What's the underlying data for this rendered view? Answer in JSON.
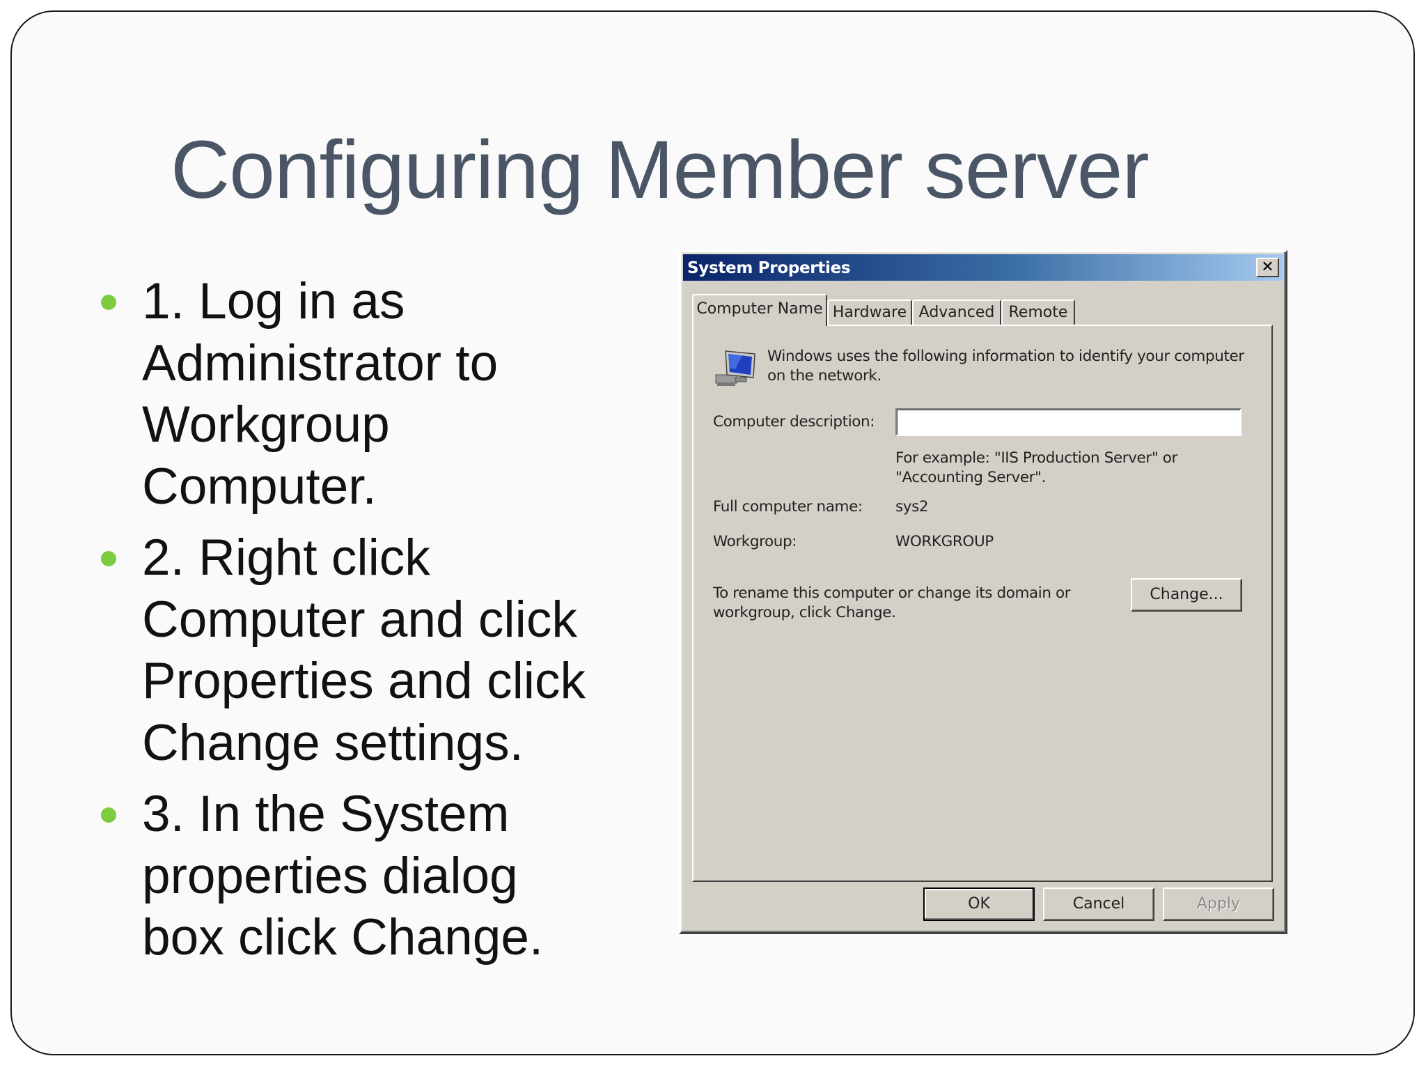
{
  "slide": {
    "title": "Configuring Member server",
    "bullets": [
      [
        "1.  Log in as",
        "Administrator to",
        "Workgroup",
        "Computer."
      ],
      [
        "2.  Right click",
        "Computer and click",
        "Properties and click",
        "Change settings."
      ],
      [
        "3.  In the System",
        "properties dialog",
        "box click Change."
      ]
    ]
  },
  "dialog": {
    "title": "System Properties",
    "close_label": "✕",
    "tabs": [
      "Computer Name",
      "Hardware",
      "Advanced",
      "Remote"
    ],
    "active_tab": "Computer Name",
    "intro_line1": "Windows uses the following information to identify your computer",
    "intro_line2": "on the network.",
    "description_label": "Computer description:",
    "description_value": "",
    "example_line1": "For example: \"IIS Production Server\" or",
    "example_line2": "\"Accounting Server\".",
    "full_name_label": "Full computer name:",
    "full_name_value": "sys2",
    "workgroup_label": "Workgroup:",
    "workgroup_value": "WORKGROUP",
    "rename_line1": "To rename this computer or change its domain or",
    "rename_line2": "workgroup, click Change.",
    "change_button": "Change...",
    "ok_button": "OK",
    "cancel_button": "Cancel",
    "apply_button": "Apply",
    "icon": "computer-monitor-icon"
  },
  "colors": {
    "title_text": "#4a5666",
    "bullet_dot": "#7ecb3f",
    "dialog_face": "#d4d0c8",
    "titlebar_start": "#0a246a",
    "titlebar_end": "#a6caf0"
  }
}
